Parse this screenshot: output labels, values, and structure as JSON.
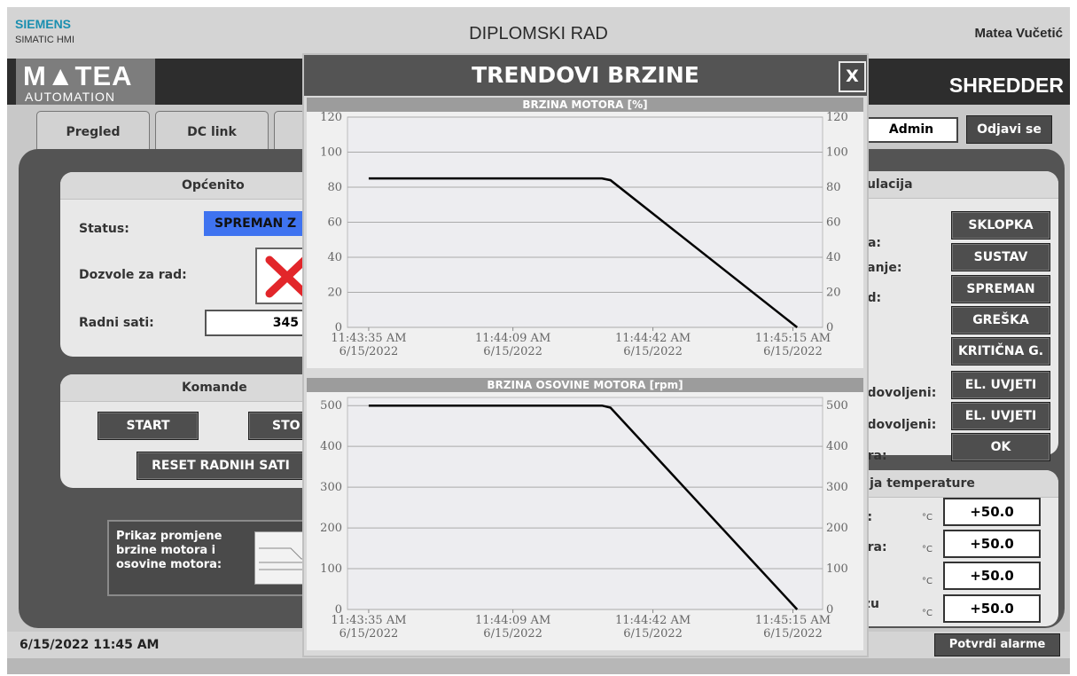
{
  "header": {
    "brand": "SIEMENS",
    "subbrand": "SIMATIC HMI",
    "title": "DIPLOMSKI RAD",
    "user": "Matea Vučetić"
  },
  "banner": {
    "logo_big": "M▲TEA",
    "logo_small": "AUTOMATION",
    "machine": "SHREDDER"
  },
  "tabs": [
    "Pregled",
    "DC link"
  ],
  "login": {
    "user": "Admin",
    "logout": "Odjavi se"
  },
  "general": {
    "title": "Općenito",
    "status_label": "Status:",
    "status_value": "SPREMAN Z",
    "permissions_label": "Dozvole za rad:",
    "hours_label": "Radni sati:",
    "hours_value": "345"
  },
  "commands": {
    "title": "Komande",
    "start": "START",
    "stop": "STO",
    "reset": "RESET RADNIH SATI"
  },
  "trend_link": {
    "label": "Prikaz promjene brzine motora i osovine motora:"
  },
  "signal": {
    "title": "nulacija",
    "rows": [
      {
        "label": "na:",
        "button": "SKLOPKA"
      },
      {
        "label": "vanje:",
        "button": "SUSTAV"
      },
      {
        "label": "ad:",
        "button": "SPREMAN"
      },
      {
        "label": ":",
        "button": "GREŠKA"
      },
      {
        "label": "",
        "button": "KRITIČNA G."
      },
      {
        "label": "adovoljeni:",
        "button": "EL. UVJETI"
      },
      {
        "label": "adovoljeni:",
        "button": "EL. UVJETI"
      },
      {
        "label": "ora:",
        "button": "OK"
      }
    ]
  },
  "temperature": {
    "title": "cija temperature",
    "unit": "°C",
    "rows": [
      {
        "label": "a:",
        "value": "+50.0"
      },
      {
        "label": "ora:",
        "value": "+50.0"
      },
      {
        "label": "",
        "value": "+50.0"
      },
      {
        "label": "izu",
        "value": "+50.0"
      }
    ]
  },
  "footer": {
    "datetime": "6/15/2022 11:45 AM",
    "ack": "Potvrdi alarme"
  },
  "popup": {
    "title": "TRENDOVI BRZINE",
    "close": "X"
  },
  "chart_data": [
    {
      "type": "line",
      "title": "BRZINA MOTORA [%]",
      "ylim": [
        0,
        120
      ],
      "yticks": [
        0,
        20,
        40,
        60,
        80,
        100,
        120
      ],
      "xlim": [
        "11:43:30 AM",
        "11:45:22 AM"
      ],
      "xticks": [
        {
          "time": "11:43:35 AM",
          "date": "6/15/2022"
        },
        {
          "time": "11:44:09 AM",
          "date": "6/15/2022"
        },
        {
          "time": "11:44:42 AM",
          "date": "6/15/2022"
        },
        {
          "time": "11:45:15 AM",
          "date": "6/15/2022"
        }
      ],
      "series": [
        {
          "x": [
            "11:43:35 AM",
            "11:44:30 AM",
            "11:44:32 AM",
            "11:45:16 AM"
          ],
          "values": [
            85,
            85,
            84,
            0
          ]
        }
      ],
      "grid": true
    },
    {
      "type": "line",
      "title": "BRZINA OSOVINE MOTORA [rpm]",
      "ylim": [
        0,
        520
      ],
      "yticks": [
        0,
        100,
        200,
        300,
        400,
        500
      ],
      "xlim": [
        "11:43:30 AM",
        "11:45:22 AM"
      ],
      "xticks": [
        {
          "time": "11:43:35 AM",
          "date": "6/15/2022"
        },
        {
          "time": "11:44:09 AM",
          "date": "6/15/2022"
        },
        {
          "time": "11:44:42 AM",
          "date": "6/15/2022"
        },
        {
          "time": "11:45:15 AM",
          "date": "6/15/2022"
        }
      ],
      "series": [
        {
          "x": [
            "11:43:35 AM",
            "11:44:30 AM",
            "11:44:32 AM",
            "11:45:16 AM"
          ],
          "values": [
            500,
            500,
            495,
            0
          ]
        }
      ],
      "grid": true
    }
  ]
}
